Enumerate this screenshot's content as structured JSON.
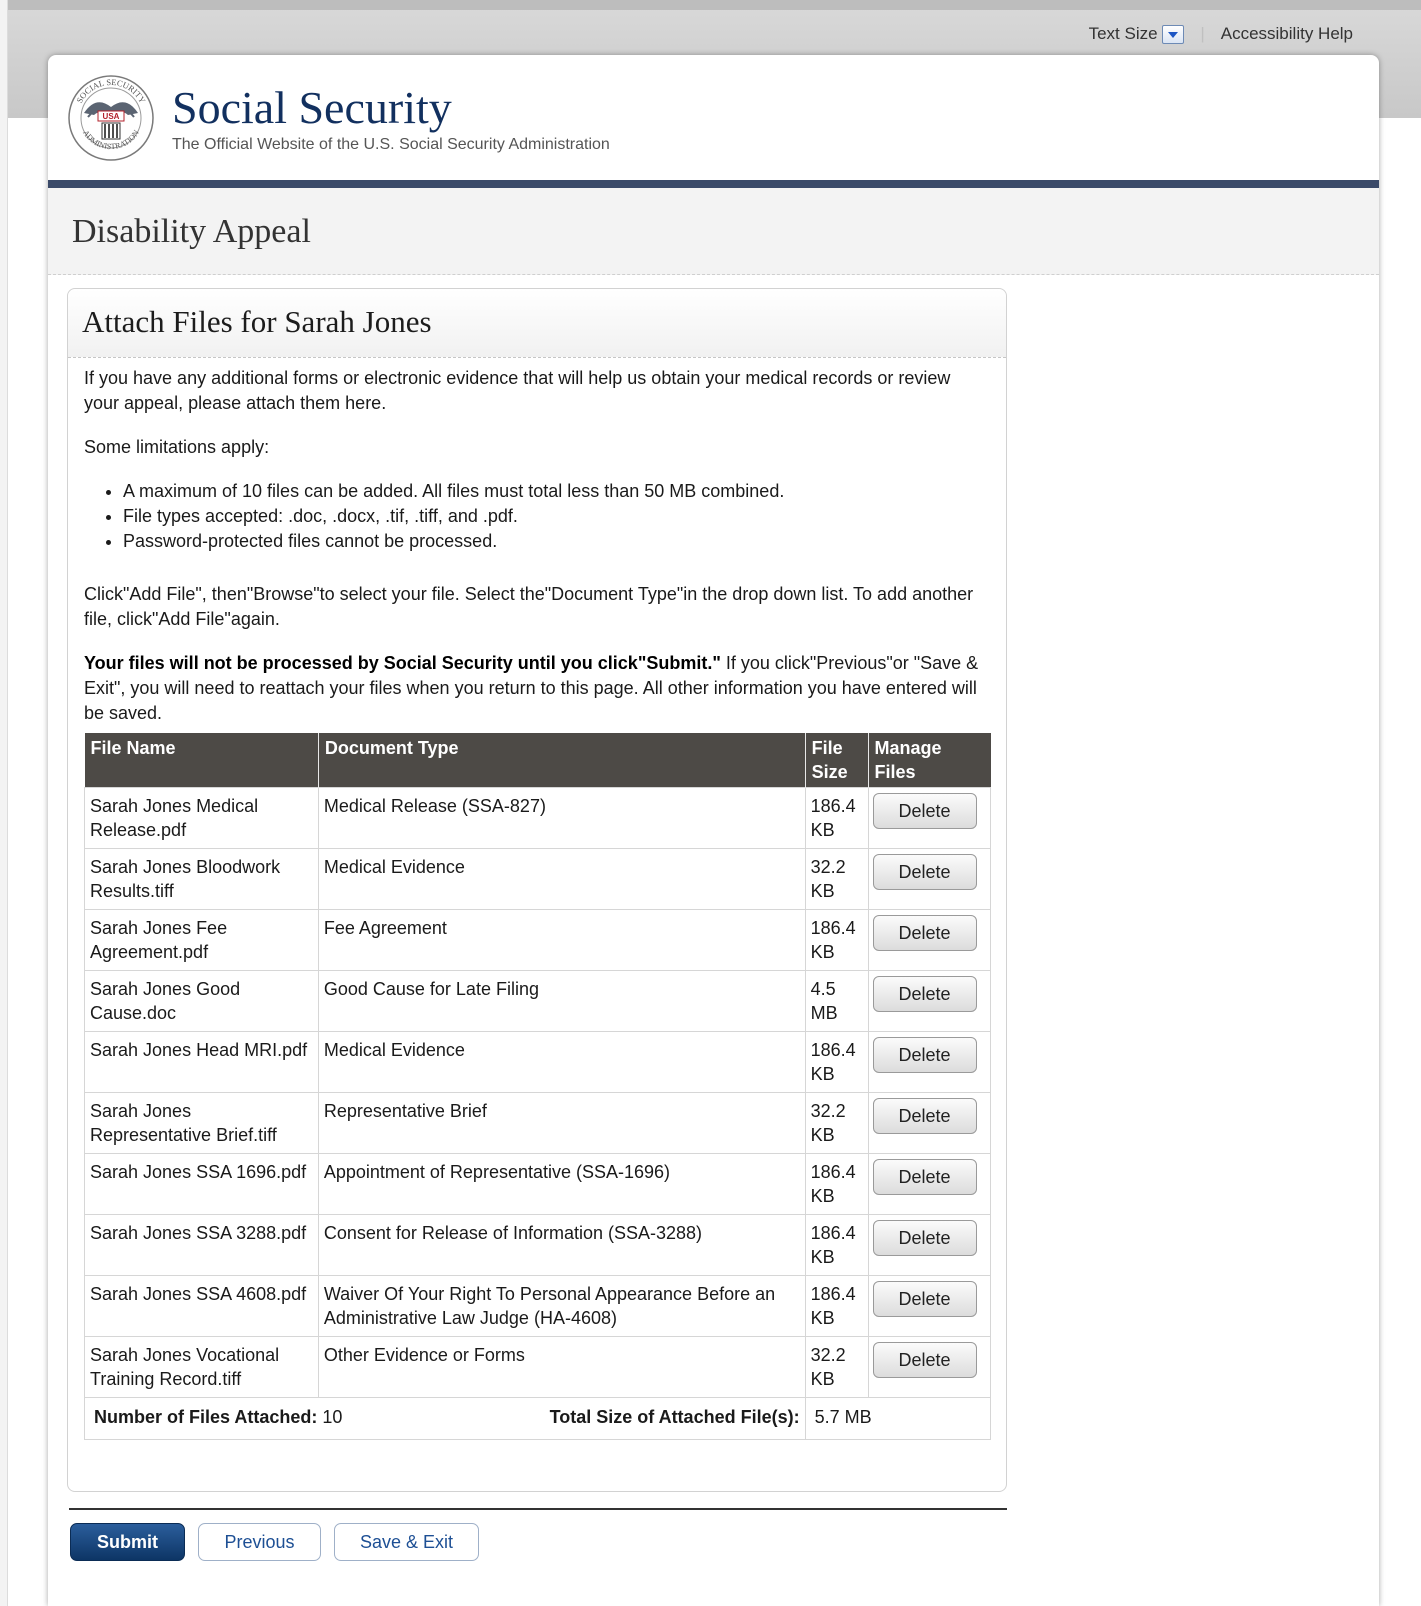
{
  "utility": {
    "text_size": "Text Size",
    "accessibility_help": "Accessibility Help"
  },
  "header": {
    "brand_title": "Social Security",
    "brand_subtitle": "The Official Website of the U.S. Social Security Administration",
    "seal_text": "SOCIAL SECURITY ADMINISTRATION USA"
  },
  "app": {
    "title": "Disability Appeal"
  },
  "panel": {
    "title": "Attach Files for Sarah Jones",
    "intro": "If you have any additional forms or electronic evidence that will help us obtain your medical records or review your appeal, please attach them here.",
    "limits_heading": "Some limitations apply:",
    "limits": [
      "A maximum of 10 files can be added. All files must total less than 50 MB combined.",
      "File types accepted: .doc, .docx, .tif, .tiff, and .pdf.",
      "Password-protected files cannot be processed."
    ],
    "instructions": "Click\"Add File\", then\"Browse\"to select your file. Select the\"Document Type\"in the drop down list. To add another file, click\"Add File\"again.",
    "notice_bold": "Your files will not be processed by Social Security until you click\"Submit.\"",
    "notice_rest": " If you click\"Previous\"or \"Save & Exit\", you will need to reattach your files when you return to this page. All other information you have entered will be saved."
  },
  "table": {
    "headers": {
      "file_name": "File Name",
      "document_type": "Document Type",
      "file_size": "File Size",
      "manage_files": "Manage Files"
    },
    "delete_label": "Delete",
    "rows": [
      {
        "file_name": "Sarah Jones Medical Release.pdf",
        "document_type": "Medical Release (SSA-827)",
        "file_size": "186.4 KB"
      },
      {
        "file_name": "Sarah Jones Bloodwork Results.tiff",
        "document_type": "Medical Evidence",
        "file_size": "32.2 KB"
      },
      {
        "file_name": "Sarah Jones Fee Agreement.pdf",
        "document_type": "Fee Agreement",
        "file_size": "186.4 KB"
      },
      {
        "file_name": "Sarah Jones Good Cause.doc",
        "document_type": "Good Cause for Late Filing",
        "file_size": "4.5 MB"
      },
      {
        "file_name": "Sarah Jones Head MRI.pdf",
        "document_type": "Medical Evidence",
        "file_size": "186.4 KB"
      },
      {
        "file_name": "Sarah Jones Representative Brief.tiff",
        "document_type": "Representative Brief",
        "file_size": "32.2 KB"
      },
      {
        "file_name": "Sarah Jones SSA 1696.pdf",
        "document_type": "Appointment of Representative (SSA-1696)",
        "file_size": "186.4 KB"
      },
      {
        "file_name": "Sarah Jones SSA 3288.pdf",
        "document_type": "Consent for Release of Information (SSA-3288)",
        "file_size": "186.4 KB"
      },
      {
        "file_name": "Sarah Jones SSA 4608.pdf",
        "document_type": "Waiver Of Your Right To Personal Appearance Before an Administrative Law Judge (HA-4608)",
        "file_size": "186.4 KB"
      },
      {
        "file_name": "Sarah Jones Vocational Training Record.tiff",
        "document_type": "Other Evidence or Forms",
        "file_size": "32.2 KB"
      }
    ],
    "totals": {
      "count_label": "Number of Files Attached:",
      "count_value": "10",
      "size_label": "Total Size of Attached File(s):",
      "size_value": "5.7 MB"
    }
  },
  "actions": {
    "submit": "Submit",
    "previous": "Previous",
    "save_exit": "Save & Exit"
  },
  "colors": {
    "navy": "#12305f",
    "header_bar": "#3b4a69",
    "table_head": "#4d4a46",
    "primary_button": "#0d3565"
  }
}
